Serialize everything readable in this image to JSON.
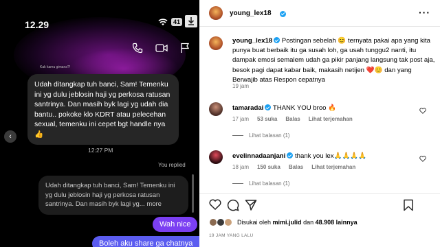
{
  "dm": {
    "status_time": "12.29",
    "battery": "41",
    "small_reply_label": "Kak kamu gimana?!",
    "received_message": "Udah ditangkap tuh banci, Sam! Temenku ini yg dulu jeblosin haji yg perkosa ratusan santrinya. Dan masih byk lagi yg udah dia bantu.. pokoke klo KDRT atau pelecehan sexual, temenku ini cepet bgt handle nya 👍",
    "message_time": "12:27 PM",
    "you_replied": "You replied",
    "quoted_message": "Udah ditangkap tuh banci, Sam! Temenku ini yg dulu jeblosin haji yg perkosa ratusan santrinya. Dan masih byk lagi yg... more",
    "sent_1": "Wah nice",
    "sent_2": "Boleh aku share ga chatnya"
  },
  "post": {
    "username": "young_lex18",
    "caption_user": "young_lex18",
    "caption_text": "Postingan sebelah 😊 ternyata pakai apa yang kita punya buat berbaik itu ga susah loh, ga usah tunggu2 nanti, itu dampak emosi semalem udah ga pikir panjang langsung tak post aja, besok pagi dapat kabar baik, makasih netijen ❤️😊 dan yang Berwajib atas Respon cepatnya",
    "caption_time": "19 jam",
    "comments": [
      {
        "user": "tamaradai",
        "text": "THANK YOU broo 🔥",
        "time": "17 jam",
        "likes": "53 suka",
        "reply": "Balas",
        "translate": "Lihat terjemahan",
        "see_replies": "Lihat balasan (1)"
      },
      {
        "user": "evelinnadaanjani",
        "text": "thank you lex🙏🙏🙏🙏",
        "time": "18 jam",
        "likes": "150 suka",
        "reply": "Balas",
        "translate": "Lihat terjemahan",
        "see_replies": "Lihat balasan (1)"
      }
    ],
    "liked_by_prefix": "Disukai oleh",
    "liked_by_user": "mimi.julid",
    "liked_by_mid": "dan",
    "liked_by_count": "48.908 lainnya",
    "post_date": "19 JAM YANG LALU"
  },
  "icons": {
    "wifi": "wifi-icon",
    "download": "download-icon",
    "call": "phone-icon",
    "video": "video-icon",
    "flag": "flag-icon",
    "heart": "heart-icon",
    "comment": "comment-icon",
    "share": "share-icon",
    "save": "bookmark-icon"
  },
  "colors": {
    "sent_bubble_1": "#7b3ff2",
    "sent_bubble_2": "#5b5cf0",
    "verified": "#1da1f2"
  }
}
